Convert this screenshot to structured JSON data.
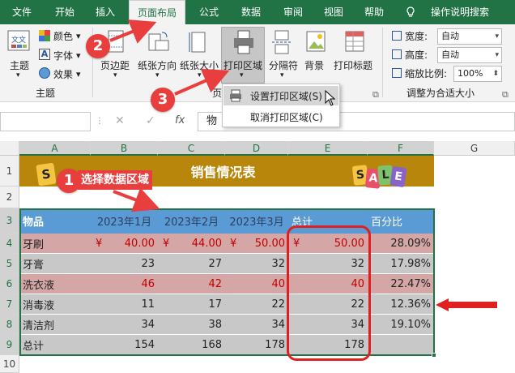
{
  "tabs": [
    "文件",
    "开始",
    "插入",
    "页面布局",
    "公式",
    "数据",
    "审阅",
    "视图",
    "帮助"
  ],
  "tell_me": "操作说明搜索",
  "ribbon": {
    "theme_btn": "主题",
    "colors": "颜色",
    "fonts": "字体",
    "effects": "效果",
    "theme_group": "主题",
    "margins": "页边距",
    "orientation": "纸张方向",
    "size": "纸张大小",
    "print_area": "打印区域",
    "breaks": "分隔符",
    "background": "背景",
    "print_titles": "打印标题",
    "page_group_prefix": "页",
    "width_label": "宽度:",
    "width_value": "自动",
    "height_label": "高度:",
    "height_value": "自动",
    "scale_label": "缩放比例:",
    "scale_value": "100%",
    "scale_group": "调整为合适大小"
  },
  "menu": {
    "set": "设置打印区域(S)",
    "clear": "取消打印区域(C)"
  },
  "formula": {
    "fx": "fx",
    "content": "物"
  },
  "callouts": {
    "one": "1",
    "two": "2",
    "three": "3",
    "note": "选择数据区域"
  },
  "colors": {
    "accent": "#217346",
    "title_band": "#b8860b",
    "header_blue": "#5b9bd5",
    "pink": "#d5a6a6",
    "gray": "#c8c8c8",
    "red": "#e83e3e",
    "currency": "#c00000"
  },
  "sheet": {
    "columns": [
      "A",
      "B",
      "C",
      "D",
      "E",
      "F",
      "G"
    ],
    "rows": [
      "1",
      "2",
      "3",
      "4",
      "5",
      "6",
      "7",
      "8",
      "9",
      "10"
    ],
    "title": "销售情况表",
    "sale_left": "S",
    "sale_right": [
      "S",
      "A",
      "L",
      "E"
    ],
    "headers": [
      "物品",
      "2023年1月",
      "2023年2月",
      "2023年3月",
      "总计",
      "百分比"
    ],
    "currency": "¥",
    "data": [
      [
        "牙刷",
        "40.00",
        "44.00",
        "50.00",
        "50.00",
        "28.09%"
      ],
      [
        "牙膏",
        "23",
        "27",
        "32",
        "32",
        "17.98%"
      ],
      [
        "洗衣液",
        "46",
        "42",
        "40",
        "40",
        "22.47%"
      ],
      [
        "消毒液",
        "11",
        "17",
        "22",
        "22",
        "12.36%"
      ],
      [
        "清洁剂",
        "34",
        "38",
        "34",
        "34",
        "19.10%"
      ],
      [
        "总计",
        "154",
        "168",
        "178",
        "178",
        ""
      ]
    ]
  }
}
